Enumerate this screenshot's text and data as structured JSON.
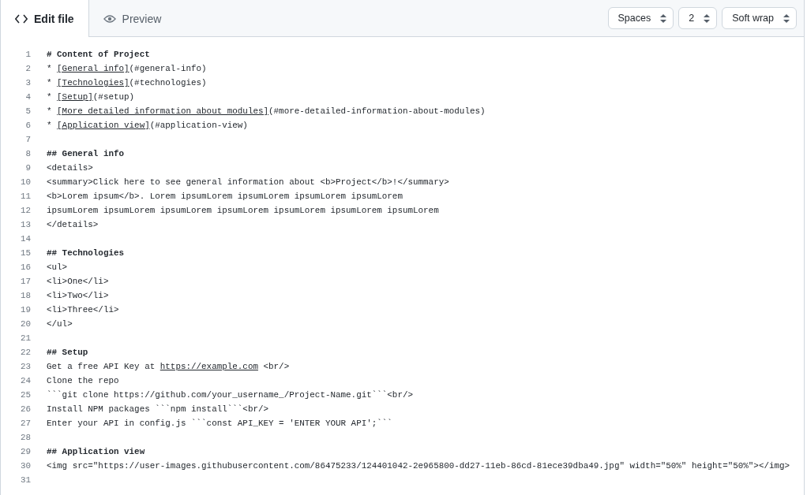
{
  "tabs": [
    {
      "label": "Edit file",
      "selected": true
    },
    {
      "label": "Preview",
      "selected": false
    }
  ],
  "selects": [
    {
      "value": "Spaces"
    },
    {
      "value": "2"
    },
    {
      "value": "Soft wrap"
    }
  ],
  "lines": [
    {
      "number": "1",
      "kind": "heading",
      "parts": [
        {
          "text": "# Content of Project",
          "kind": "plain"
        }
      ]
    },
    {
      "number": "2",
      "kind": "code",
      "parts": [
        {
          "text": "* ",
          "kind": "plain"
        },
        {
          "text": "[General info]",
          "kind": "link"
        },
        {
          "text": "(#general-info)",
          "kind": "plain"
        }
      ]
    },
    {
      "number": "3",
      "kind": "code",
      "parts": [
        {
          "text": "* ",
          "kind": "plain"
        },
        {
          "text": "[Technologies]",
          "kind": "link"
        },
        {
          "text": "(#technologies)",
          "kind": "plain"
        }
      ]
    },
    {
      "number": "4",
      "kind": "code",
      "parts": [
        {
          "text": "* ",
          "kind": "plain"
        },
        {
          "text": "[Setup]",
          "kind": "link"
        },
        {
          "text": "(#setup)",
          "kind": "plain"
        }
      ]
    },
    {
      "number": "5",
      "kind": "code",
      "parts": [
        {
          "text": "* ",
          "kind": "plain"
        },
        {
          "text": "[More detailed information about modules]",
          "kind": "link"
        },
        {
          "text": "(#more-detailed-information-about-modules)",
          "kind": "plain"
        }
      ]
    },
    {
      "number": "6",
      "kind": "code",
      "parts": [
        {
          "text": "* ",
          "kind": "plain"
        },
        {
          "text": "[Application view]",
          "kind": "link"
        },
        {
          "text": "(#application-view)",
          "kind": "plain"
        }
      ]
    },
    {
      "number": "7",
      "kind": "blank"
    },
    {
      "number": "8",
      "kind": "heading",
      "parts": [
        {
          "text": "## General info",
          "kind": "plain"
        }
      ]
    },
    {
      "number": "9",
      "kind": "code",
      "parts": [
        {
          "text": "<details>",
          "kind": "plain"
        }
      ]
    },
    {
      "number": "10",
      "kind": "code",
      "parts": [
        {
          "text": "<summary>Click here to see general information about <b>Project</b>!</summary>",
          "kind": "plain"
        }
      ]
    },
    {
      "number": "11",
      "kind": "code",
      "parts": [
        {
          "text": "<b>Lorem ipsum</b>. Lorem ipsumLorem ipsumLorem ipsumLorem ipsumLorem",
          "kind": "plain"
        }
      ]
    },
    {
      "number": "12",
      "kind": "code",
      "parts": [
        {
          "text": "ipsumLorem ipsumLorem ipsumLorem ipsumLorem ipsumLorem ipsumLorem ipsumLorem",
          "kind": "plain"
        }
      ]
    },
    {
      "number": "13",
      "kind": "code",
      "parts": [
        {
          "text": "</details>",
          "kind": "plain"
        }
      ]
    },
    {
      "number": "14",
      "kind": "blank"
    },
    {
      "number": "15",
      "kind": "heading",
      "parts": [
        {
          "text": "## Technologies",
          "kind": "plain"
        }
      ]
    },
    {
      "number": "16",
      "kind": "code",
      "parts": [
        {
          "text": "<ul>",
          "kind": "plain"
        }
      ]
    },
    {
      "number": "17",
      "kind": "code",
      "parts": [
        {
          "text": "<li>One</li>",
          "kind": "plain"
        }
      ]
    },
    {
      "number": "18",
      "kind": "code",
      "parts": [
        {
          "text": "<li>Two</li>",
          "kind": "plain"
        }
      ]
    },
    {
      "number": "19",
      "kind": "code",
      "parts": [
        {
          "text": "<li>Three</li>",
          "kind": "plain"
        }
      ]
    },
    {
      "number": "20",
      "kind": "code",
      "parts": [
        {
          "text": "</ul>",
          "kind": "plain"
        }
      ]
    },
    {
      "number": "21",
      "kind": "blank"
    },
    {
      "number": "22",
      "kind": "heading",
      "parts": [
        {
          "text": "## Setup",
          "kind": "plain"
        }
      ]
    },
    {
      "number": "23",
      "kind": "code",
      "parts": [
        {
          "text": "Get a free API Key at ",
          "kind": "plain"
        },
        {
          "text": "https://example.com",
          "kind": "link"
        },
        {
          "text": " <br/>",
          "kind": "plain"
        }
      ]
    },
    {
      "number": "24",
      "kind": "code",
      "parts": [
        {
          "text": "Clone the repo",
          "kind": "plain"
        }
      ]
    },
    {
      "number": "25",
      "kind": "code",
      "parts": [
        {
          "text": "```git clone https://github.com/your_username_/Project-Name.git```<br/>",
          "kind": "plain"
        }
      ]
    },
    {
      "number": "26",
      "kind": "code",
      "parts": [
        {
          "text": "Install NPM packages ```npm install```<br/>",
          "kind": "plain"
        }
      ]
    },
    {
      "number": "27",
      "kind": "code",
      "parts": [
        {
          "text": "Enter your API in config.js ```const API_KEY = 'ENTER YOUR API';```",
          "kind": "plain"
        }
      ]
    },
    {
      "number": "28",
      "kind": "blank"
    },
    {
      "number": "29",
      "kind": "heading",
      "parts": [
        {
          "text": "## Application view",
          "kind": "plain"
        }
      ]
    },
    {
      "number": "30",
      "kind": "code",
      "parts": [
        {
          "text": "<img src=\"https://user-images.githubusercontent.com/86475233/124401042-2e965800-dd27-11eb-86cd-81ece39dba49.jpg\" width=\"50%\" height=\"50%\"></img>",
          "kind": "plain"
        }
      ]
    },
    {
      "number": "31",
      "kind": "blank"
    }
  ]
}
